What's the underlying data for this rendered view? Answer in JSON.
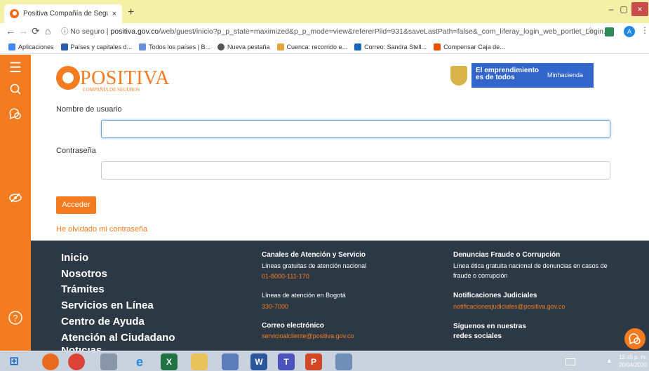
{
  "browser": {
    "tab_title": "Positiva Compañía de Seguros - ",
    "tab_close": "×",
    "new_tab": "+",
    "url_prefix": "No seguro",
    "url_domain": "positiva.gov.co",
    "url_path": "/web/guest/inicio?p_p_state=maximized&p_p_mode=view&refererPlid=931&saveLastPath=false&_com_liferay_login_web_portlet_Login...",
    "profile_initial": "A",
    "bookmarks": [
      {
        "label": "Aplicaciones",
        "color": "#4285f4"
      },
      {
        "label": "Países y capitales d...",
        "color": "#2a5caa"
      },
      {
        "label": "Todos los países | B...",
        "color": "#6a8fd6"
      },
      {
        "label": "Nueva pestaña",
        "color": "#555555"
      },
      {
        "label": "Cuenca: recorrido e...",
        "color": "#e8a33c"
      },
      {
        "label": "Correo: Sandra Stell...",
        "color": "#1565c0"
      },
      {
        "label": "Compensar Caja de...",
        "color": "#e65100"
      }
    ]
  },
  "header": {
    "logo_name": "POSITIVA",
    "logo_sub": "COMPAÑÍA DE SEGUROS",
    "gov_text_line1": "El emprendimiento",
    "gov_text_line2": "es de todos",
    "gov_ministry": "Minhacienda"
  },
  "login": {
    "username_label": "Nombre de usuario",
    "username_value": "",
    "password_label": "Contraseña",
    "password_value": "",
    "submit_label": "Acceder",
    "forgot_label": "He olvidado mi contraseña"
  },
  "footer": {
    "nav": [
      "Inicio",
      "Nosotros",
      "Trámites",
      "Servicios en Línea",
      "Centro de Ayuda",
      "Atención al Ciudadano",
      "Noticias"
    ],
    "col2": {
      "heading": "Canales de Atención y Servicio",
      "line1": "Líneas gratuitas de atención nacional",
      "phone1": "01-8000-111-170",
      "line2": "Líneas de atención en Bogotá",
      "phone2": "330-7000",
      "mail_heading": "Correo electrónico",
      "mail": "servicioalcliente@positiva.gov.co"
    },
    "col3": {
      "heading": "Denuncias Fraude o Corrupción",
      "line1": "Línea ética gratuita nacional de denuncias en casos de",
      "line2": "fraude o corrupción",
      "notif_heading": "Notificaciones Judiciales",
      "notif_mail": "notificacionesjudiciales@positiva.gov.co",
      "social1": "Síguenos en nuestras",
      "social2": "redes sociales"
    }
  },
  "taskbar": {
    "time": "12:45 p. m.",
    "date": "20/04/2020"
  },
  "colors": {
    "brand_orange": "#f47c20",
    "footer_bg": "#2c3945",
    "gov_blue": "#3366cc"
  }
}
